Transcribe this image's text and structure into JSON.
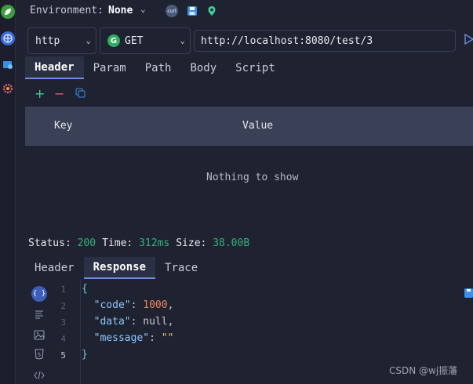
{
  "toolbar": {
    "env_label": "Environment:",
    "env_value": "None",
    "curl_label": "curl"
  },
  "request": {
    "protocol": "http",
    "method_badge": "G",
    "method": "GET",
    "url": "http://localhost:8080/test/3"
  },
  "request_tabs": [
    "Header",
    "Param",
    "Path",
    "Body",
    "Script"
  ],
  "table": {
    "col_key": "Key",
    "col_value": "Value",
    "empty_text": "Nothing to show"
  },
  "status_bar": {
    "status_label": "Status:",
    "status_value": "200",
    "time_label": "Time:",
    "time_value": "312ms",
    "size_label": "Size:",
    "size_value": "38.00B"
  },
  "response_tabs": [
    "Header",
    "Response",
    "Trace"
  ],
  "response_body": {
    "line_numbers": [
      "1",
      "2",
      "3",
      "4",
      "5"
    ],
    "open_brace": "{",
    "code_key": "\"code\"",
    "code_value": "1000",
    "data_key": "\"data\"",
    "data_value": "null",
    "message_key": "\"message\"",
    "message_value": "\"\"",
    "close_brace": "}"
  },
  "watermark": "CSDN @wj振藩",
  "colors": {
    "accent": "#6e8fe6",
    "status_green": "#35b37e",
    "method_green": "#2fae5f"
  }
}
